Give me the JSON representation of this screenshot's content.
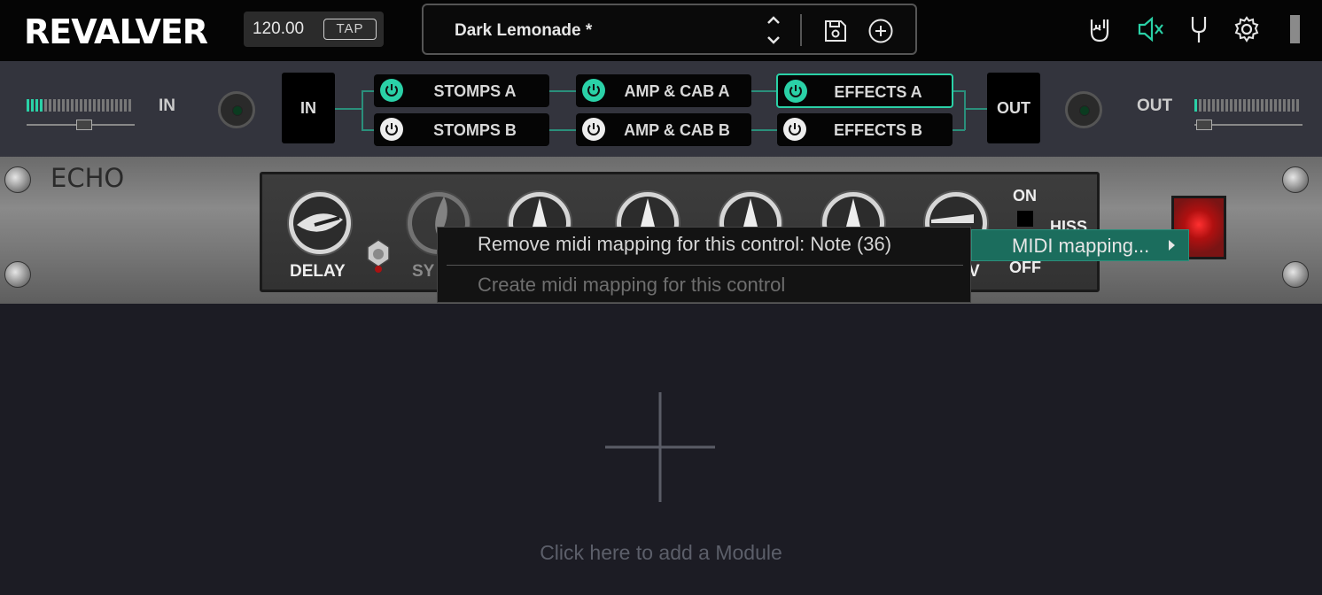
{
  "app": {
    "logo": "REVALVER"
  },
  "topbar": {
    "tempo": "120.00",
    "tap_label": "TAP",
    "preset_name": "Dark Lemonade *",
    "icons": [
      "rock-hand-icon",
      "speaker-mute-icon",
      "tuning-fork-icon",
      "gear-icon"
    ]
  },
  "routing": {
    "in_label": "IN",
    "out_label": "OUT",
    "in_box": "IN",
    "out_box": "OUT",
    "input_meter_level": 0.17,
    "output_meter_level": 0.03,
    "modules": [
      {
        "label": "STOMPS A",
        "on": true,
        "selected": false
      },
      {
        "label": "STOMPS B",
        "on": false,
        "selected": false
      },
      {
        "label": "AMP & CAB A",
        "on": true,
        "selected": false
      },
      {
        "label": "AMP & CAB B",
        "on": false,
        "selected": false
      },
      {
        "label": "EFFECTS A",
        "on": true,
        "selected": true
      },
      {
        "label": "EFFECTS B",
        "on": false,
        "selected": false
      }
    ]
  },
  "echo": {
    "title": "ECHO",
    "knob_labels": {
      "delay": "DELAY",
      "sync_partial": "SY",
      "last_partial": "V"
    },
    "switch": {
      "on": "ON",
      "off": "OFF",
      "hiss_partial": "HISS"
    }
  },
  "context_menu": {
    "items": [
      {
        "label": "Remove midi mapping for this control: Note (36)",
        "enabled": true
      },
      {
        "label": "Create midi mapping for this control",
        "enabled": false
      }
    ],
    "parent_item": "MIDI mapping..."
  },
  "empty_area": {
    "add_module_text": "Click here to add a Module"
  }
}
